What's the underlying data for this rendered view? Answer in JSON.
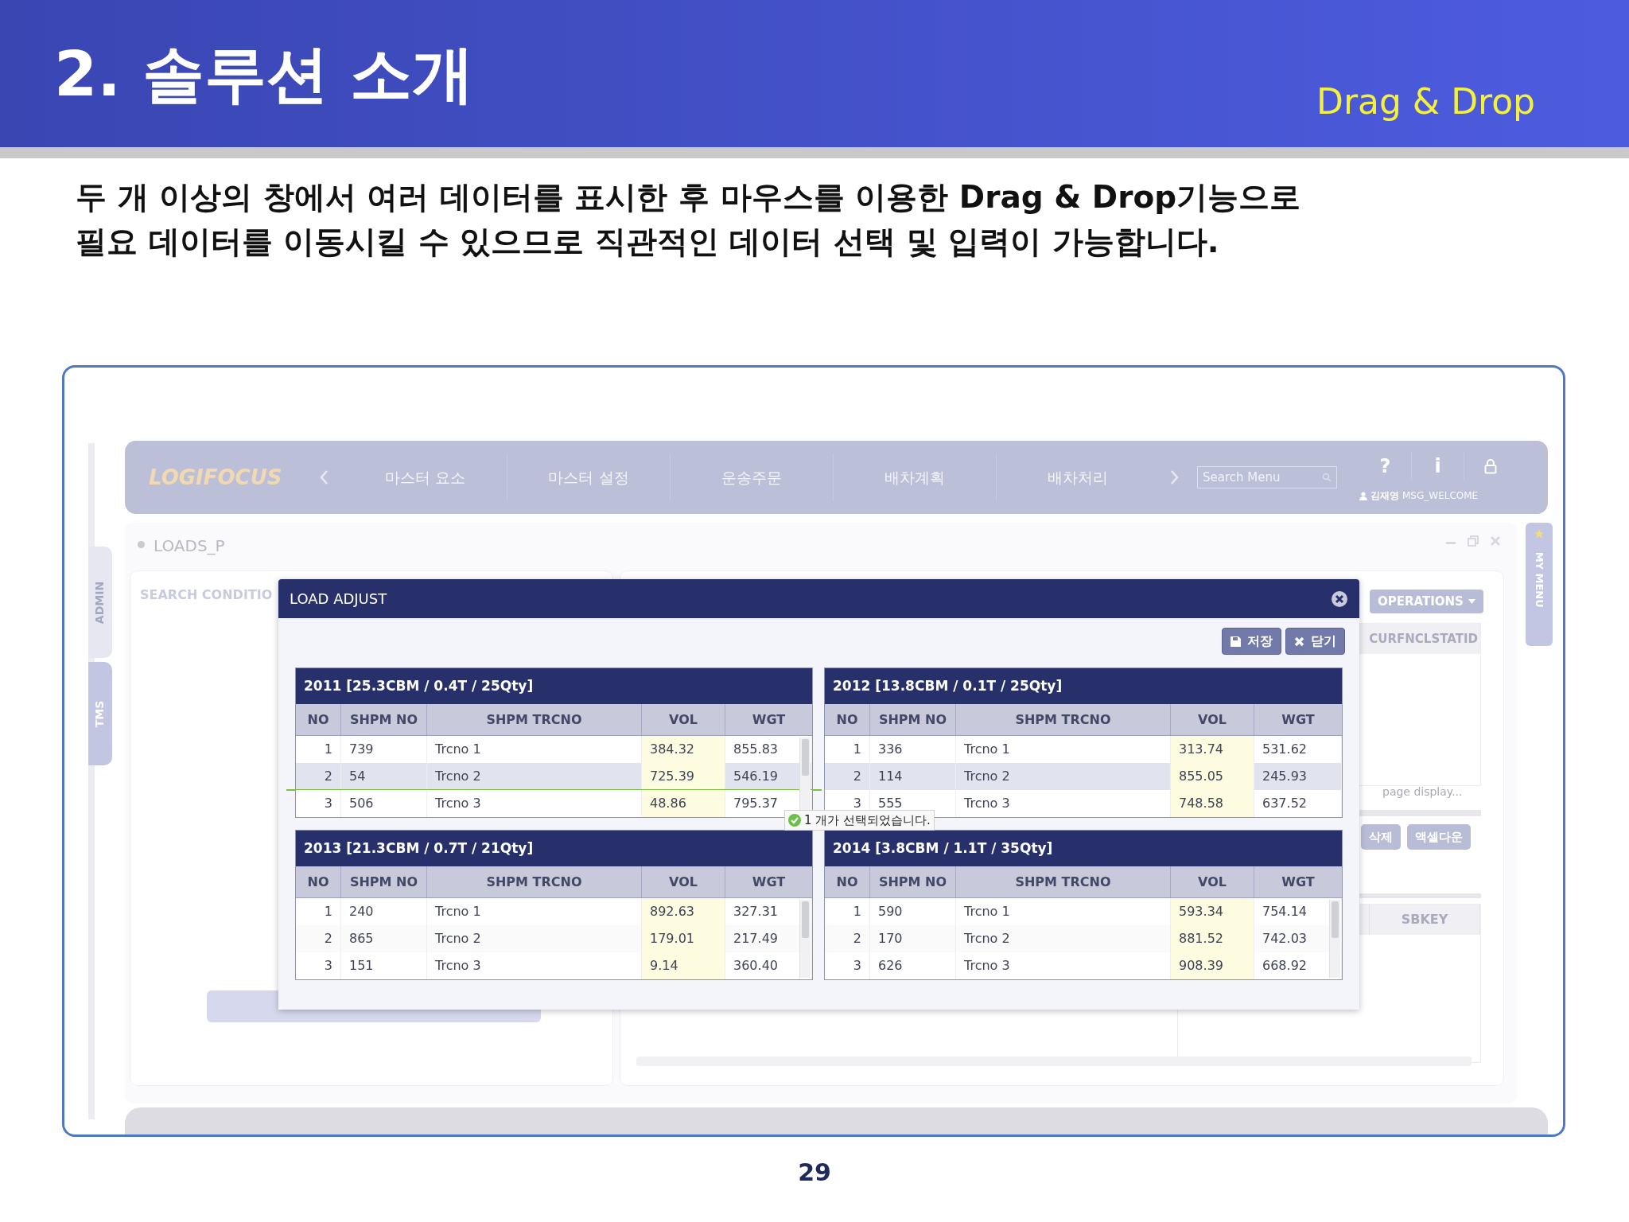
{
  "slide": {
    "title": "2. 솔루션 소개",
    "subtitle": "Drag & Drop",
    "description": [
      "두 개 이상의 창에서 여러 데이터를 표시한 후 마우스를 이용한 Drag & Drop기능으로",
      "필요 데이터를 이동시킬 수 있으므로 직관적인 데이터 선택 및 입력이 가능합니다."
    ],
    "page_number": "29"
  },
  "app": {
    "logo": "LOGIFOCUS",
    "nav": {
      "items": [
        "마스터 요소",
        "마스터 설정",
        "운송주문",
        "배차계획",
        "배차처리"
      ],
      "search": {
        "placeholder": "Search Menu"
      },
      "help": "?",
      "info": "i",
      "user": "김재영",
      "welcome": "MSG_WELCOME"
    },
    "side_tabs": [
      "ADMIN",
      "TMS"
    ],
    "right_tab": "MY MENU",
    "window": {
      "title": "LOADS_P",
      "search_label": "SEARCH CONDITIO",
      "operations": "OPERATIONS",
      "column_1": "CURFNCLSTATID",
      "page_display": "page display...",
      "buttons": [
        "삭제",
        "액셀다운"
      ],
      "column_2": "SBKEY"
    },
    "dialog": {
      "title": "LOAD ADJUST",
      "buttons": [
        "저장",
        "닫기"
      ],
      "grids": [
        {
          "title": "2011 [25.3CBM / 0.4T / 25Qty]",
          "scrollbar": true,
          "columns": [
            "NO",
            "SHPM NO",
            "SHPM TRCNO",
            "VOL",
            "WGT"
          ],
          "rows": [
            {
              "cells": [
                "1",
                "739",
                "Trcno 1",
                "384.32",
                "855.83"
              ],
              "selected": false,
              "drop_after": false
            },
            {
              "cells": [
                "2",
                "54",
                "Trcno 2",
                "725.39",
                "546.19"
              ],
              "selected": true,
              "drop_after": true
            },
            {
              "cells": [
                "3",
                "506",
                "Trcno 3",
                "48.86",
                "795.37"
              ],
              "selected": false,
              "drop_after": false
            }
          ]
        },
        {
          "title": "2012 [13.8CBM / 0.1T / 25Qty]",
          "scrollbar": false,
          "columns": [
            "NO",
            "SHPM NO",
            "SHPM TRCNO",
            "VOL",
            "WGT"
          ],
          "rows": [
            {
              "cells": [
                "1",
                "336",
                "Trcno 1",
                "313.74",
                "531.62"
              ],
              "selected": false,
              "drop_after": false
            },
            {
              "cells": [
                "2",
                "114",
                "Trcno 2",
                "855.05",
                "245.93"
              ],
              "selected": true,
              "drop_after": false
            },
            {
              "cells": [
                "3",
                "555",
                "Trcno 3",
                "748.58",
                "637.52"
              ],
              "selected": false,
              "drop_after": false
            }
          ]
        },
        {
          "title": "2013 [21.3CBM / 0.7T / 21Qty]",
          "scrollbar": true,
          "columns": [
            "NO",
            "SHPM NO",
            "SHPM TRCNO",
            "VOL",
            "WGT"
          ],
          "rows": [
            {
              "cells": [
                "1",
                "240",
                "Trcno 1",
                "892.63",
                "327.31"
              ],
              "selected": false,
              "drop_after": false
            },
            {
              "cells": [
                "2",
                "865",
                "Trcno 2",
                "179.01",
                "217.49"
              ],
              "selected": false,
              "drop_after": false
            },
            {
              "cells": [
                "3",
                "151",
                "Trcno 3",
                "9.14",
                "360.40"
              ],
              "selected": false,
              "drop_after": false
            }
          ]
        },
        {
          "title": "2014 [3.8CBM / 1.1T / 35Qty]",
          "scrollbar": true,
          "columns": [
            "NO",
            "SHPM NO",
            "SHPM TRCNO",
            "VOL",
            "WGT"
          ],
          "rows": [
            {
              "cells": [
                "1",
                "590",
                "Trcno 1",
                "593.34",
                "754.14"
              ],
              "selected": false,
              "drop_after": false
            },
            {
              "cells": [
                "2",
                "170",
                "Trcno 2",
                "881.52",
                "742.03"
              ],
              "selected": false,
              "drop_after": false
            },
            {
              "cells": [
                "3",
                "626",
                "Trcno 3",
                "908.39",
                "668.92"
              ],
              "selected": false,
              "drop_after": false
            }
          ]
        }
      ],
      "toast": "1 개가 선택되었습니다."
    }
  }
}
